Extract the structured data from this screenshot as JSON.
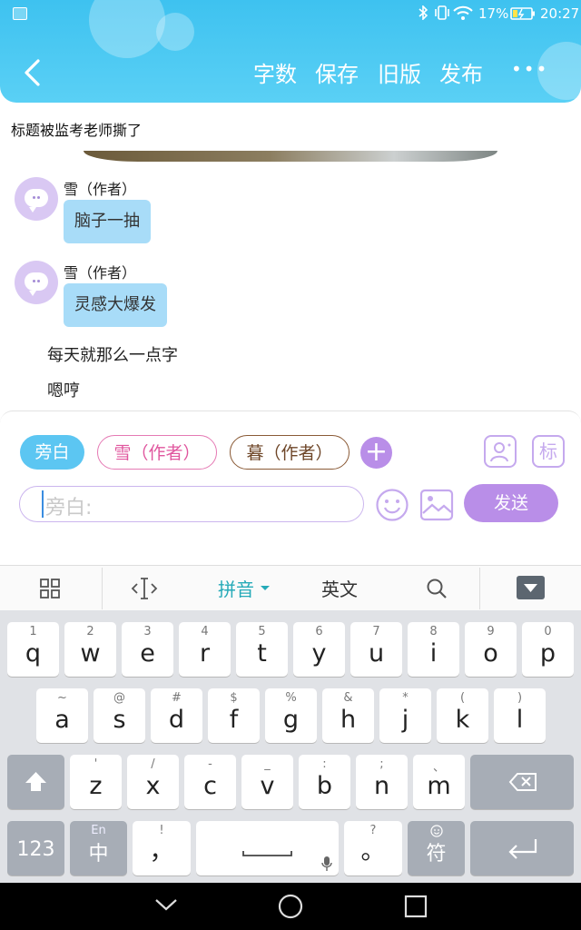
{
  "status_bar": {
    "battery": "17%",
    "time": "20:27"
  },
  "header": {
    "actions": [
      "字数",
      "保存",
      "旧版",
      "发布"
    ],
    "more": "•••"
  },
  "story": {
    "title": "标题被监考老师撕了",
    "messages": [
      {
        "speaker": "雪（作者）",
        "text": "脑子一抽"
      },
      {
        "speaker": "雪（作者）",
        "text": "灵感大爆发"
      }
    ],
    "narration": [
      "每天就那么一点字",
      "嗯哼"
    ]
  },
  "editor": {
    "roles": [
      "旁白",
      "雪（作者）",
      "暮（作者）"
    ],
    "add_role": "+",
    "tag_button": "标",
    "input_placeholder": "旁白:",
    "send": "发送"
  },
  "keyboard": {
    "toolbar": {
      "ime_mode": "拼音",
      "english": "英文"
    },
    "row1": [
      {
        "k": "q",
        "h": "1"
      },
      {
        "k": "w",
        "h": "2"
      },
      {
        "k": "e",
        "h": "3"
      },
      {
        "k": "r",
        "h": "4"
      },
      {
        "k": "t",
        "h": "5"
      },
      {
        "k": "y",
        "h": "6"
      },
      {
        "k": "u",
        "h": "7"
      },
      {
        "k": "i",
        "h": "8"
      },
      {
        "k": "o",
        "h": "9"
      },
      {
        "k": "p",
        "h": "0"
      }
    ],
    "row2": [
      {
        "k": "a",
        "h": "~"
      },
      {
        "k": "s",
        "h": "@"
      },
      {
        "k": "d",
        "h": "#"
      },
      {
        "k": "f",
        "h": "$"
      },
      {
        "k": "g",
        "h": "%"
      },
      {
        "k": "h",
        "h": "&"
      },
      {
        "k": "j",
        "h": "*"
      },
      {
        "k": "k",
        "h": "("
      },
      {
        "k": "l",
        "h": ")"
      }
    ],
    "row3": [
      {
        "k": "z",
        "h": "'"
      },
      {
        "k": "x",
        "h": "/"
      },
      {
        "k": "c",
        "h": "-"
      },
      {
        "k": "v",
        "h": "_"
      },
      {
        "k": "b",
        "h": ":"
      },
      {
        "k": "n",
        "h": ";"
      },
      {
        "k": "m",
        "h": "、"
      }
    ],
    "num_key": "123",
    "lang_hint": "En",
    "lang_key": "中",
    "comma_hint": "!",
    "comma_key": "，",
    "period_hint": "?",
    "period_key": "。",
    "symbol_key": "符"
  },
  "colors": {
    "header": "#3ec2f0",
    "accent": "#b98ee8",
    "bubble": "#a8dcf8",
    "role_active": "#5cc6f2",
    "role_xue": "#e57ab4",
    "role_mu": "#8a5a36"
  }
}
